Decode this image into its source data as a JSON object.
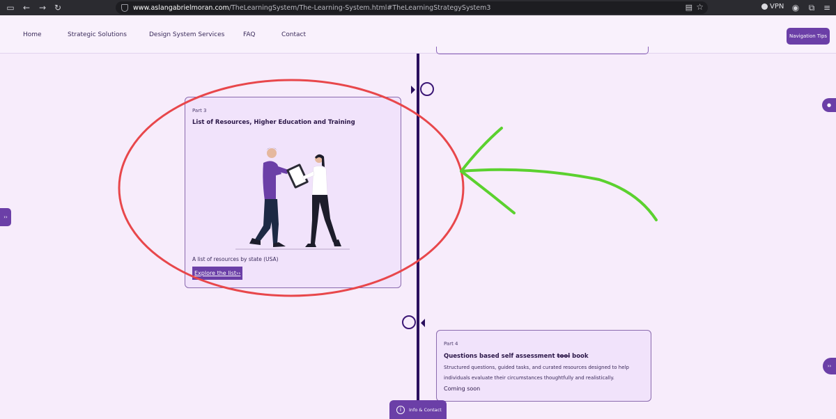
{
  "browser": {
    "url_domain": "www.aslangabrielmoran.com",
    "url_path": "/TheLearningSystem/The-Learning-System.html#TheLearningStrategySystem3",
    "vpn_label": "VPN"
  },
  "nav": {
    "links": [
      "Home",
      "Strategic Solutions",
      "Design System Services",
      "FAQ",
      "Contact"
    ],
    "tips_button": "Navigation Tips"
  },
  "part3": {
    "part": "Part 3",
    "title": "List of Resources, Higher Education and Training",
    "desc": "A list of resources by state (USA)",
    "cta": "Explore the list››"
  },
  "part4": {
    "part": "Part 4",
    "title_before": "Questions based self assessment ",
    "title_strike": "tool",
    "title_after": " book",
    "desc": "Structured questions, guided tasks, and curated resources designed to help individuals evaluate their circumstances thoughtfully and realistically.",
    "status": "Coming soon"
  },
  "side_tab_label": "››",
  "info_button": "Info & Contact",
  "colors": {
    "accent": "#6b3fa7",
    "timeline": "#2a0f5e",
    "annotation_red": "#e8474b",
    "annotation_green": "#5bd12f"
  }
}
